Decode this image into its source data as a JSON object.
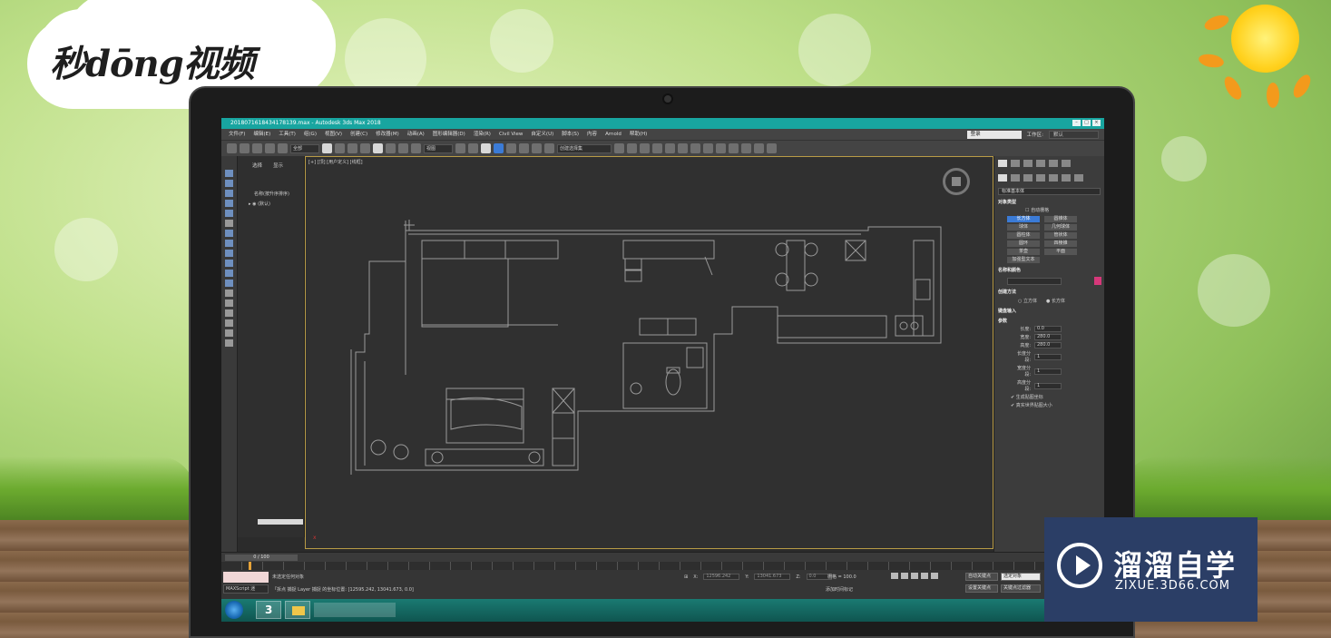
{
  "brand": {
    "logo_text": "秒dōng视频"
  },
  "window": {
    "title": "20180716184341781​39.max - Autodesk 3ds Max 2018",
    "menus": [
      "文件(F)",
      "编辑(E)",
      "工具(T)",
      "组(G)",
      "视图(V)",
      "创建(C)",
      "修改器(M)",
      "动画(A)",
      "图形编辑器(D)",
      "渲染(R)",
      "Civil View",
      "自定义(U)",
      "脚本(S)",
      "内容",
      "Arnold",
      "帮助(H)"
    ],
    "user_field": "登录",
    "workspace_label": "工作区:",
    "workspace_value": "默认"
  },
  "toolbar": {
    "selection_filter": "全部",
    "coord_system": "视图",
    "named_selection": "创建选择集"
  },
  "scene_explorer": {
    "tab_select": "选择",
    "tab_display": "显示",
    "column_header": "名称(按升序排序)",
    "root_item": "(默认)"
  },
  "viewport": {
    "label": "[+] [顶] [用户定义] [线框]",
    "axis_label": "x"
  },
  "command_panel": {
    "category": "标准基本体",
    "object_type_header": "对象类型",
    "autogrid": "自动栅格",
    "primitives": [
      "长方体",
      "圆锥体",
      "球体",
      "几何球体",
      "圆柱体",
      "管状体",
      "圆环",
      "四棱锥",
      "茶壶",
      "平面",
      "加强型文本"
    ],
    "name_color_header": "名称和颜色",
    "swatch_color": "#d6387a",
    "creation_method_header": "创建方法",
    "creation_methods": [
      "立方体",
      "长方体"
    ],
    "keyboard_entry_header": "键盘输入",
    "params_header": "参数",
    "params": [
      {
        "label": "长度:",
        "value": "0.0"
      },
      {
        "label": "宽度:",
        "value": "280.0"
      },
      {
        "label": "高度:",
        "value": "280.0"
      },
      {
        "label": "长度分段:",
        "value": "1"
      },
      {
        "label": "宽度分段:",
        "value": "1"
      },
      {
        "label": "高度分段:",
        "value": "1"
      }
    ],
    "gen_mapping": "生成贴图坐标",
    "real_world": "真实世界贴图大小"
  },
  "timeline": {
    "frame_counter": "0 / 100",
    "current_frame": 0,
    "total_frames": 100
  },
  "status": {
    "maxscript_label": "MAXScript 迷",
    "line1": "未选定任何对象",
    "line2": "「拆点 捕捉 Layer 捕捉 的坐标位置: [12595.242, 13041.673, 0.0]",
    "x_label": "X:",
    "x_value": "12596.242",
    "y_label": "Y:",
    "y_value": "13041.673",
    "z_label": "Z:",
    "z_value": "0.0",
    "grid": "栅格 = 100.0",
    "add_time_tag": "添加时间标记",
    "auto_key": "自动关键点",
    "selected_objects": "选定对象",
    "set_key": "设置关键点",
    "key_filters": "关键点过滤器"
  },
  "watermark": {
    "title": "溜溜自学",
    "subtitle": "ZIXUE.3D66.COM"
  }
}
